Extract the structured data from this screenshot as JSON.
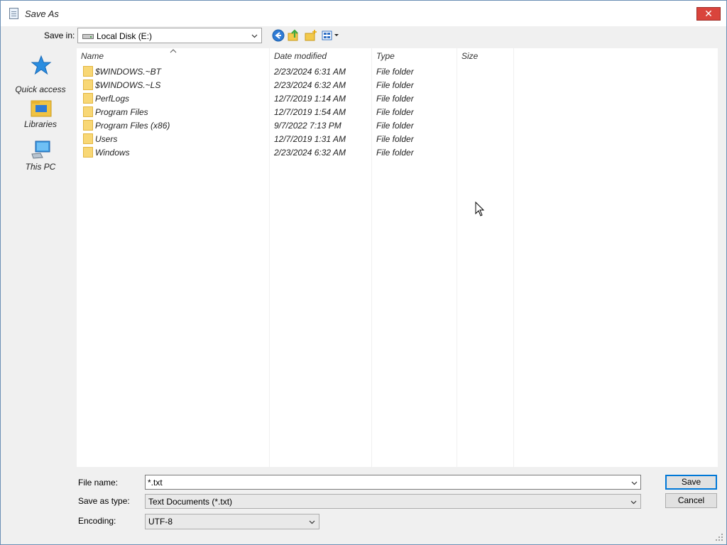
{
  "window": {
    "title": "Save As",
    "close_glyph": "✕"
  },
  "toolbar": {
    "save_in_label": "Save in:",
    "save_in_value": "Local Disk (E:)",
    "icons": [
      "back-icon",
      "up-folder-icon",
      "new-folder-icon",
      "views-menu-icon"
    ]
  },
  "places": [
    {
      "label": "Quick access",
      "icon": "star-icon"
    },
    {
      "label": "Libraries",
      "icon": "libraries-icon"
    },
    {
      "label": "This PC",
      "icon": "computer-icon"
    }
  ],
  "filelist": {
    "columns": [
      "Name",
      "Date modified",
      "Type",
      "Size"
    ],
    "rows": [
      {
        "name": "$WINDOWS.~BT",
        "date": "2/23/2024 6:31 AM",
        "type": "File folder"
      },
      {
        "name": "$WINDOWS.~LS",
        "date": "2/23/2024 6:32 AM",
        "type": "File folder"
      },
      {
        "name": "PerfLogs",
        "date": "12/7/2019 1:14 AM",
        "type": "File folder"
      },
      {
        "name": "Program Files",
        "date": "12/7/2019 1:54 AM",
        "type": "File folder"
      },
      {
        "name": "Program Files (x86)",
        "date": "9/7/2022 7:13 PM",
        "type": "File folder"
      },
      {
        "name": "Users",
        "date": "12/7/2019 1:31 AM",
        "type": "File folder"
      },
      {
        "name": "Windows",
        "date": "2/23/2024 6:32 AM",
        "type": "File folder"
      }
    ]
  },
  "form": {
    "file_name_label": "File name:",
    "file_name_value": "*.txt",
    "save_as_type_label": "Save as type:",
    "save_as_type_value": "Text Documents (*.txt)",
    "encoding_label": "Encoding:",
    "encoding_value": "UTF-8",
    "save_button": "Save",
    "cancel_button": "Cancel"
  },
  "colors": {
    "accent": "#0078d7",
    "close_button": "#d9443c",
    "folder": "#f8d775"
  }
}
